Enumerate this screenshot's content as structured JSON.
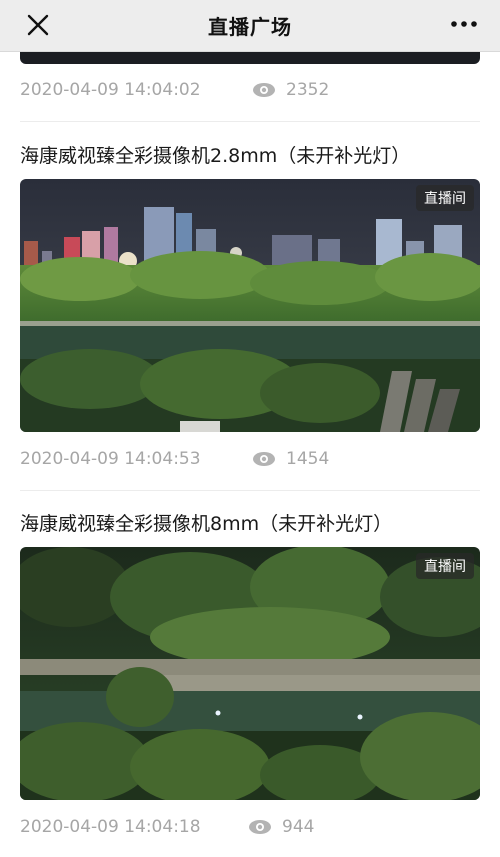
{
  "header": {
    "title": "直播广场"
  },
  "feed": {
    "previous": {
      "time": "2020-04-09 14:04:02",
      "views": "2352"
    },
    "items": [
      {
        "title": "海康威视臻全彩摄像机2.8mm（未开补光灯）",
        "badge": "直播间",
        "time": "2020-04-09 14:04:53",
        "views": "1454"
      },
      {
        "title": "海康威视臻全彩摄像机8mm（未开补光灯）",
        "badge": "直播间",
        "time": "2020-04-09 14:04:18",
        "views": "944"
      }
    ]
  },
  "icons": {
    "close": "close-icon",
    "more": "more-icon",
    "views": "eye-icon"
  },
  "colors": {
    "header_bg": "#ededed",
    "meta_text": "#a6a6a6",
    "badge_bg": "#282828"
  }
}
